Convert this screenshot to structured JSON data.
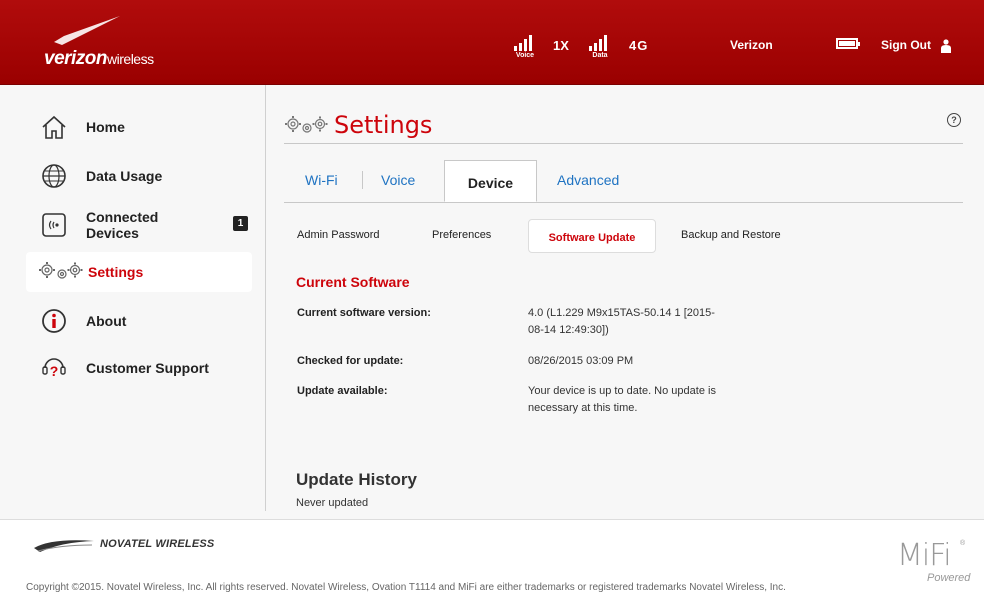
{
  "header": {
    "logo": {
      "brand_bold": "verizon",
      "brand_rest": "wireless"
    },
    "signals": [
      {
        "label": "Voice",
        "tech": "1X"
      },
      {
        "label": "Data",
        "tech": "4G"
      }
    ],
    "carrier": "Verizon",
    "sign_out": "Sign Out"
  },
  "sidebar": {
    "items": [
      {
        "label": "Home",
        "icon": "home-icon"
      },
      {
        "label": "Data Usage",
        "icon": "globe-icon"
      },
      {
        "label": "Connected Devices",
        "icon": "connected-devices-icon",
        "badge": "1"
      },
      {
        "label": "Settings",
        "icon": "gears-icon",
        "active": true
      },
      {
        "label": "About",
        "icon": "info-icon"
      },
      {
        "label": "Customer Support",
        "icon": "support-icon"
      }
    ]
  },
  "main": {
    "title": "Settings",
    "help_symbol": "?",
    "tabs": [
      {
        "label": "Wi-Fi"
      },
      {
        "label": "Voice"
      },
      {
        "label": "Device",
        "active": true
      },
      {
        "label": "Advanced"
      }
    ],
    "subtabs": [
      {
        "label": "Admin Password"
      },
      {
        "label": "Preferences"
      },
      {
        "label": "Software Update",
        "active": true
      },
      {
        "label": "Backup and Restore"
      }
    ],
    "current_software": {
      "title": "Current Software",
      "rows": [
        {
          "label": "Current software version:",
          "value": "4.0 (L1.229 M9x15TAS-50.14 1 [2015-08-14 12:49:30])"
        },
        {
          "label": "Checked for update:",
          "value": "08/26/2015 03:09 PM"
        },
        {
          "label": "Update available:",
          "value": "Your device is up to date. No update is necessary at this time."
        }
      ]
    },
    "update_history": {
      "title": "Update History",
      "text": "Never updated"
    }
  },
  "footer": {
    "company_logo": "NOVATEL WIRELESS",
    "copyright": "Copyright ©2015. Novatel Wireless, Inc. All rights reserved. Novatel Wireless, Ovation T1114 and MiFi are either trademarks or registered trademarks Novatel Wireless, Inc.",
    "mifi": "MiFi",
    "mifi_reg": "®",
    "powered": "Powered"
  },
  "colors": {
    "brand_red": "#cd040b",
    "header_red": "#a80303",
    "link_blue": "#1f73c2"
  }
}
